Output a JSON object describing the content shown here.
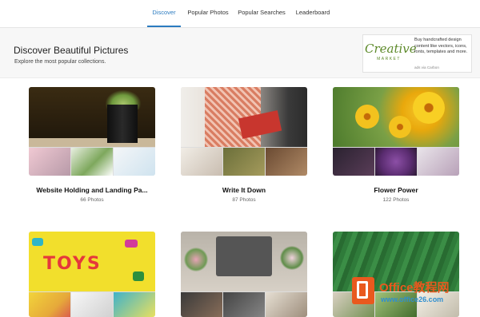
{
  "nav": {
    "tabs": [
      {
        "label": "Discover",
        "active": true
      },
      {
        "label": "Popular Photos",
        "active": false
      },
      {
        "label": "Popular Searches",
        "active": false
      },
      {
        "label": "Leaderboard",
        "active": false
      }
    ]
  },
  "header": {
    "title": "Discover Beautiful Pictures",
    "subtitle": "Explore the most popular collections."
  },
  "ad": {
    "logo_word": "Creative",
    "logo_sub": "MARKET",
    "text": "Buy handcrafted design content like vectors, icons, fonts, templates and more.",
    "via": "ads via Carbon"
  },
  "collections": [
    {
      "title": "Website Holding and Landing Pa...",
      "count": "66 Photos"
    },
    {
      "title": "Write It Down",
      "count": "87 Photos"
    },
    {
      "title": "Flower Power",
      "count": "122 Photos"
    },
    {
      "title": "",
      "count": ""
    },
    {
      "title": "",
      "count": ""
    },
    {
      "title": "",
      "count": ""
    }
  ],
  "toys_text": "TOYS",
  "watermark": {
    "name": "Office教程网",
    "url": "www.office26.com"
  },
  "colors": {
    "accent": "#2b7bc0",
    "brand_green": "#5d8a2a",
    "watermark_orange": "#e9591e"
  }
}
